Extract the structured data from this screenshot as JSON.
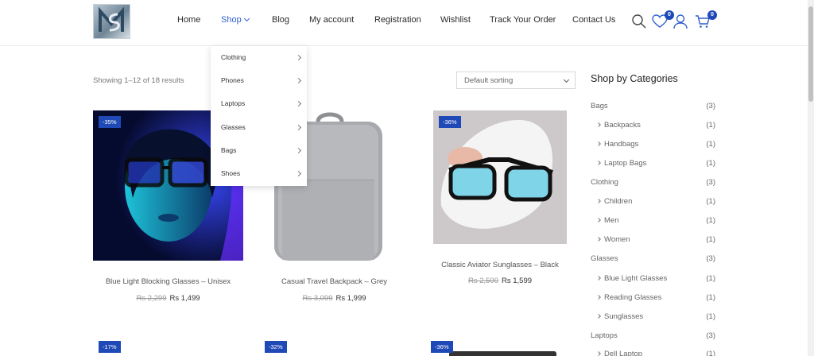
{
  "nav": {
    "items": [
      "Home",
      "Shop",
      "Blog",
      "My account",
      "Registration",
      "Wishlist",
      "Track Your Order",
      "Contact Us"
    ],
    "wishlist_count": "0",
    "cart_count": "0"
  },
  "shop_menu": [
    "Clothing",
    "Phones",
    "Laptops",
    "Glasses",
    "Bags",
    "Shoes"
  ],
  "toolbar": {
    "result_count": "Showing 1–12 of 18 results",
    "sort_value": "Default sorting"
  },
  "products": [
    {
      "discount": "-35%",
      "title": "Blue Light Blocking Glasses – Unisex",
      "old_price": "Rs 2,299",
      "price": "Rs 1,499"
    },
    {
      "discount": "",
      "title": "Casual Travel Backpack – Grey",
      "old_price": "Rs 3,099",
      "price": "Rs 1,999"
    },
    {
      "discount": "-36%",
      "title": "Classic Aviator Sunglasses – Black",
      "old_price": "Rs 2,500",
      "price": "Rs 1,599"
    }
  ],
  "next_row_discounts": [
    "-17%",
    "-32%",
    "-36%"
  ],
  "sidebar": {
    "title": "Shop by Categories",
    "categories": [
      {
        "label": "Bags",
        "count": "(3)"
      },
      {
        "label": "Backpacks",
        "count": "(1)"
      },
      {
        "label": "Handbags",
        "count": "(1)"
      },
      {
        "label": "Laptop Bags",
        "count": "(1)"
      },
      {
        "label": "Clothing",
        "count": "(3)"
      },
      {
        "label": "Children",
        "count": "(1)"
      },
      {
        "label": "Men",
        "count": "(1)"
      },
      {
        "label": "Women",
        "count": "(1)"
      },
      {
        "label": "Glasses",
        "count": "(3)"
      },
      {
        "label": "Blue Light Glasses",
        "count": "(1)"
      },
      {
        "label": "Reading Glasses",
        "count": "(1)"
      },
      {
        "label": "Sunglasses",
        "count": "(1)"
      },
      {
        "label": "Laptops",
        "count": "(3)"
      },
      {
        "label": "Dell Laptop",
        "count": "(1)"
      }
    ]
  },
  "colors": {
    "accent": "#2f5fd0",
    "badge": "#1f49b6"
  }
}
